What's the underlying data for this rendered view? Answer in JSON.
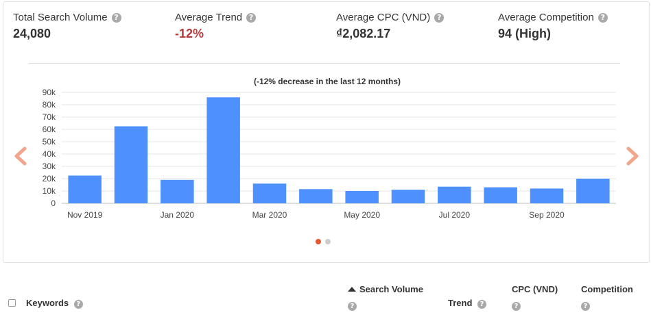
{
  "metrics": {
    "total_search_volume": {
      "label": "Total Search Volume",
      "value": "24,080"
    },
    "average_trend": {
      "label": "Average Trend",
      "value": "-12%"
    },
    "average_cpc": {
      "label": "Average CPC (VND)",
      "value": "₫2,082.17"
    },
    "average_competition": {
      "label": "Average Competition",
      "value": "94 (High)"
    }
  },
  "help_glyph": "?",
  "chart_data": {
    "type": "bar",
    "title": "(-12% decrease in the last 12 months)",
    "months": [
      "Nov 2019",
      "Dec 2019",
      "Jan 2020",
      "Feb 2020",
      "Mar 2020",
      "Apr 2020",
      "May 2020",
      "Jun 2020",
      "Jul 2020",
      "Aug 2020",
      "Sep 2020",
      "Oct 2020"
    ],
    "x_tick_labels": [
      "Nov 2019",
      "Jan 2020",
      "Mar 2020",
      "May 2020",
      "Jul 2020",
      "Sep 2020"
    ],
    "values": [
      22500,
      62500,
      19000,
      86000,
      16000,
      11500,
      10000,
      11000,
      13500,
      13000,
      12000,
      20000
    ],
    "y_tick_labels": [
      "0",
      "10k",
      "20k",
      "30k",
      "40k",
      "50k",
      "60k",
      "70k",
      "80k",
      "90k"
    ],
    "ylim": [
      0,
      90000
    ],
    "grid": true,
    "bar_color": "#4d90fe"
  },
  "carousel": {
    "pages": 2,
    "active": 0,
    "arrow_color": "#f0a58c"
  },
  "table": {
    "keywords": "Keywords",
    "search_volume": "Search Volume",
    "trend": "Trend",
    "cpc": "CPC (VND)",
    "competition": "Competition"
  }
}
